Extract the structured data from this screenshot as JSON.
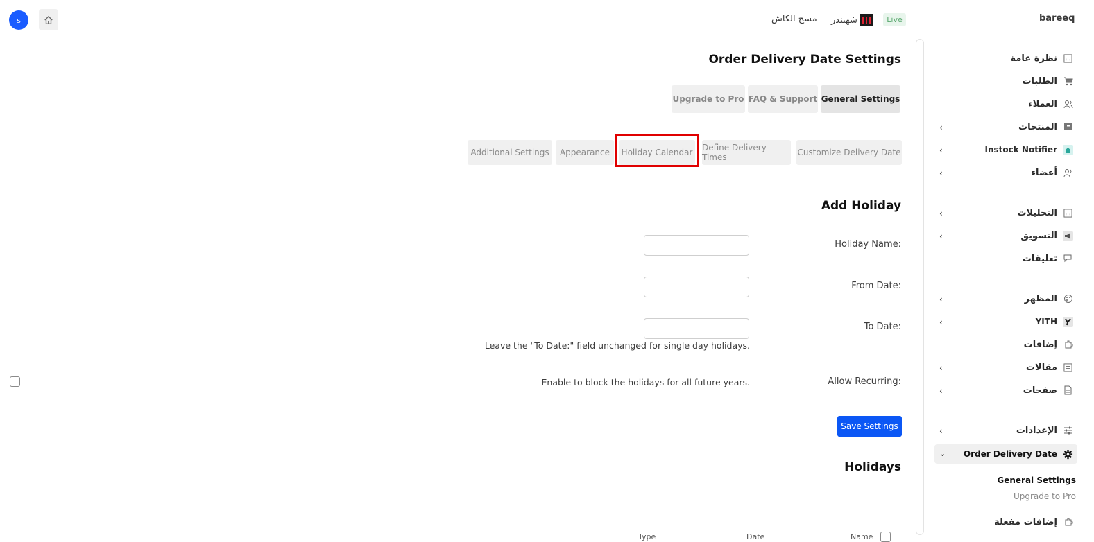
{
  "topbar": {
    "avatar_initial": "s",
    "home_icon": "home-icon",
    "clear_cache": "مسح الكاش",
    "brand": "شهبندر",
    "live": "Live",
    "store": "bareeq"
  },
  "sidebar": {
    "items": [
      {
        "label": "نظرة عامة",
        "icon": "chart-icon"
      },
      {
        "label": "الطلبات",
        "icon": "cart-icon"
      },
      {
        "label": "العملاء",
        "icon": "users-icon"
      },
      {
        "label": "المنتجات",
        "icon": "archive-icon"
      },
      {
        "label": "Instock Notifier",
        "icon": "notifier-icon"
      },
      {
        "label": "أعضاء",
        "icon": "members-icon"
      },
      {
        "label": "التحليلات",
        "icon": "analytics-icon"
      },
      {
        "label": "التسويق",
        "icon": "megaphone-icon"
      },
      {
        "label": "تعليقات",
        "icon": "comments-icon"
      },
      {
        "label": "المظهر",
        "icon": "palette-icon"
      },
      {
        "label": "YITH",
        "icon": "yith-icon"
      },
      {
        "label": "إضافات",
        "icon": "plugin-icon"
      },
      {
        "label": "مقالات",
        "icon": "posts-icon"
      },
      {
        "label": "صفحات",
        "icon": "pages-icon"
      },
      {
        "label": "الإعدادات",
        "icon": "settings-sliders-icon"
      },
      {
        "label": "Order Delivery Date",
        "icon": "gear-icon"
      }
    ],
    "sub_items": [
      "General Settings",
      "Upgrade to Pro"
    ],
    "active_plugins": "إضافات مفعلة"
  },
  "main": {
    "title": "Order Delivery Date Settings",
    "tabs": [
      "General Settings",
      "FAQ & Support",
      "Upgrade to Pro"
    ],
    "subtabs": [
      "Customize Delivery Date",
      "Define Delivery Times",
      "Holiday Calendar",
      "Appearance",
      "Additional Settings"
    ],
    "add_holiday": "Add Holiday",
    "labels": {
      "holiday_name": "Holiday Name:",
      "from_date": "From Date:",
      "to_date": "To Date:",
      "allow_recurring": "Allow Recurring:"
    },
    "to_date_hint": "Leave the \"To Date:\" field unchanged for single day holidays.",
    "recurring_hint": "Enable to block the holidays for all future years.",
    "save": "Save Settings",
    "holidays": "Holidays",
    "table_headers": [
      "Name",
      "Date",
      "Type"
    ]
  }
}
